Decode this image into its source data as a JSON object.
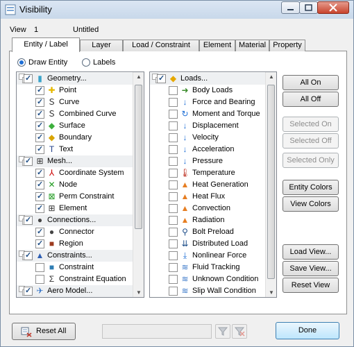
{
  "window": {
    "title": "Visibility",
    "view_label": "View",
    "view_number": "1",
    "view_name": "Untitled"
  },
  "tabs": [
    "Entity / Label",
    "Layer",
    "Load / Constraint",
    "Element",
    "Material",
    "Property"
  ],
  "draw": {
    "entity_label": "Draw Entity",
    "labels_label": "Labels"
  },
  "left_list": [
    {
      "label": "Geometry...",
      "type": "group",
      "checked": true
    },
    {
      "label": "Point",
      "checked": true
    },
    {
      "label": "Curve",
      "checked": true
    },
    {
      "label": "Combined Curve",
      "checked": true
    },
    {
      "label": "Surface",
      "checked": true
    },
    {
      "label": "Boundary",
      "checked": true
    },
    {
      "label": "Text",
      "checked": true
    },
    {
      "label": "Mesh...",
      "type": "group",
      "checked": true
    },
    {
      "label": "Coordinate System",
      "checked": true
    },
    {
      "label": "Node",
      "checked": true
    },
    {
      "label": "Perm Constraint",
      "checked": true
    },
    {
      "label": "Element",
      "checked": true
    },
    {
      "label": "Connections...",
      "type": "group",
      "checked": true
    },
    {
      "label": "Connector",
      "checked": true
    },
    {
      "label": "Region",
      "checked": true
    },
    {
      "label": "Constraints...",
      "type": "group",
      "checked": true
    },
    {
      "label": "Constraint",
      "checked": false
    },
    {
      "label": "Constraint Equation",
      "checked": false
    },
    {
      "label": "Aero Model...",
      "type": "group",
      "checked": true
    }
  ],
  "right_list": [
    {
      "label": "Loads...",
      "type": "group",
      "checked": true
    },
    {
      "label": "Body Loads",
      "checked": false
    },
    {
      "label": "Force and Bearing",
      "checked": false
    },
    {
      "label": "Moment and Torque",
      "checked": false
    },
    {
      "label": "Displacement",
      "checked": false
    },
    {
      "label": "Velocity",
      "checked": false
    },
    {
      "label": "Acceleration",
      "checked": false
    },
    {
      "label": "Pressure",
      "checked": false
    },
    {
      "label": "Temperature",
      "checked": false
    },
    {
      "label": "Heat Generation",
      "checked": false
    },
    {
      "label": "Heat Flux",
      "checked": false
    },
    {
      "label": "Convection",
      "checked": false
    },
    {
      "label": "Radiation",
      "checked": false
    },
    {
      "label": "Bolt Preload",
      "checked": false
    },
    {
      "label": "Distributed Load",
      "checked": false
    },
    {
      "label": "Nonlinear Force",
      "checked": false
    },
    {
      "label": "Fluid Tracking",
      "checked": false
    },
    {
      "label": "Unknown Condition",
      "checked": false
    },
    {
      "label": "Slip Wall Condition",
      "checked": false
    }
  ],
  "buttons": {
    "all_on": "All On",
    "all_off": "All Off",
    "selected_on": "Selected On",
    "selected_off": "Selected Off",
    "selected_only": "Selected Only",
    "entity_colors": "Entity Colors",
    "view_colors": "View Colors",
    "load_view": "Load View...",
    "save_view": "Save View...",
    "reset_view": "Reset View",
    "reset_all": "Reset All",
    "done": "Done"
  },
  "colors": {
    "accent": "#1e6fd6",
    "done_border": "#3c7fb1"
  }
}
